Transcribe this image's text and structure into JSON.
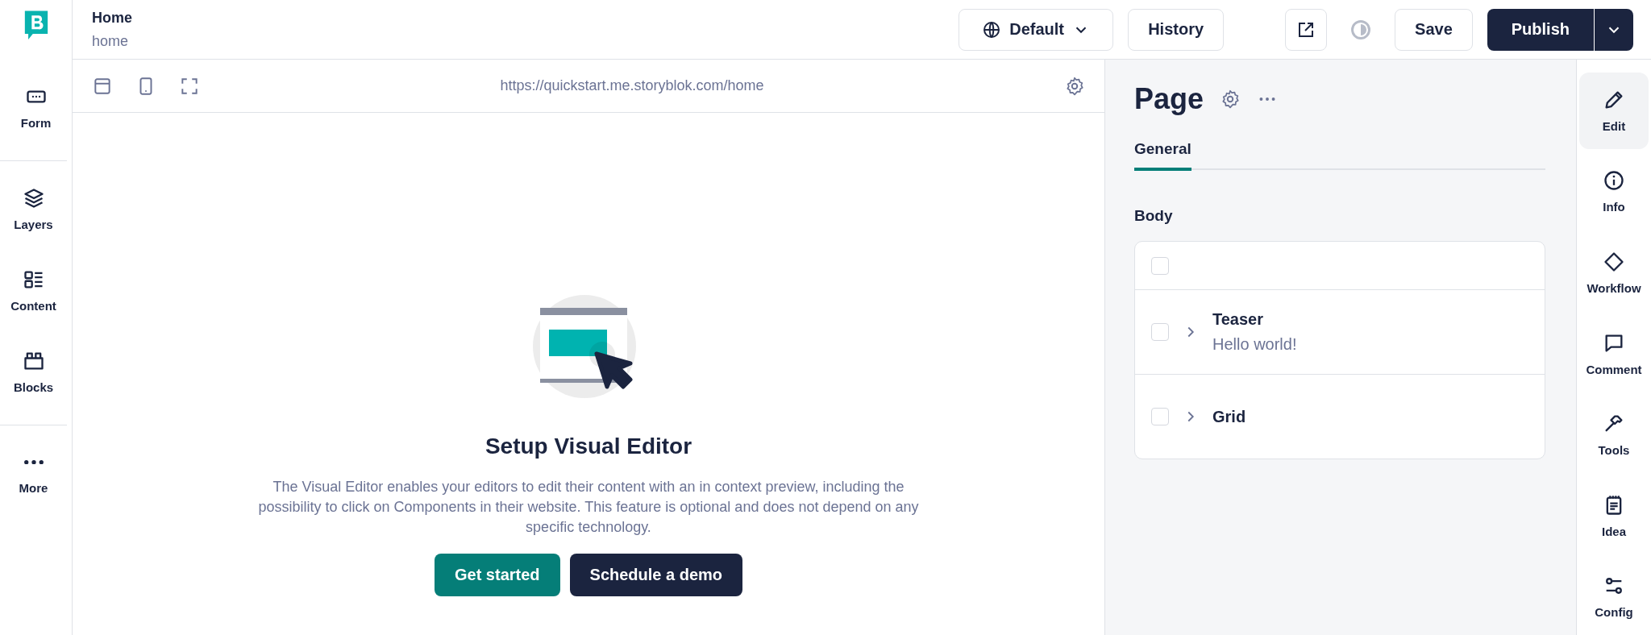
{
  "header": {
    "title": "Home",
    "slug": "home",
    "language": "Default",
    "history": "History",
    "save": "Save",
    "publish": "Publish"
  },
  "left_nav": [
    [
      {
        "label": "Form"
      }
    ],
    [
      {
        "label": "Layers"
      },
      {
        "label": "Content"
      },
      {
        "label": "Blocks"
      }
    ],
    [
      {
        "label": "More"
      }
    ]
  ],
  "preview": {
    "url": "https://quickstart.me.storyblok.com/home",
    "empty_state": {
      "title": "Setup Visual Editor",
      "description": "The Visual Editor enables your editors to edit their content with an in context preview, including the possibility to click on Components in their website. This feature is optional and does not depend on any specific technology.",
      "primary_button": "Get started",
      "secondary_button": "Schedule a demo"
    }
  },
  "panel": {
    "title": "Page",
    "tabs": [
      {
        "label": "General",
        "selected": true
      }
    ],
    "field_label": "Body",
    "select_all_checked": false,
    "blocks": [
      {
        "title": "Teaser",
        "subtitle": "Hello world!",
        "checked": false
      },
      {
        "title": "Grid",
        "checked": false
      }
    ]
  },
  "right_rail": [
    {
      "label": "Edit",
      "selected": true
    },
    {
      "label": "Info",
      "selected": false
    },
    {
      "label": "Workflow",
      "selected": false
    },
    {
      "label": "Comment",
      "selected": false
    },
    {
      "label": "Tools",
      "selected": false
    },
    {
      "label": "Idea",
      "selected": false
    },
    {
      "label": "Config",
      "selected": false
    }
  ]
}
